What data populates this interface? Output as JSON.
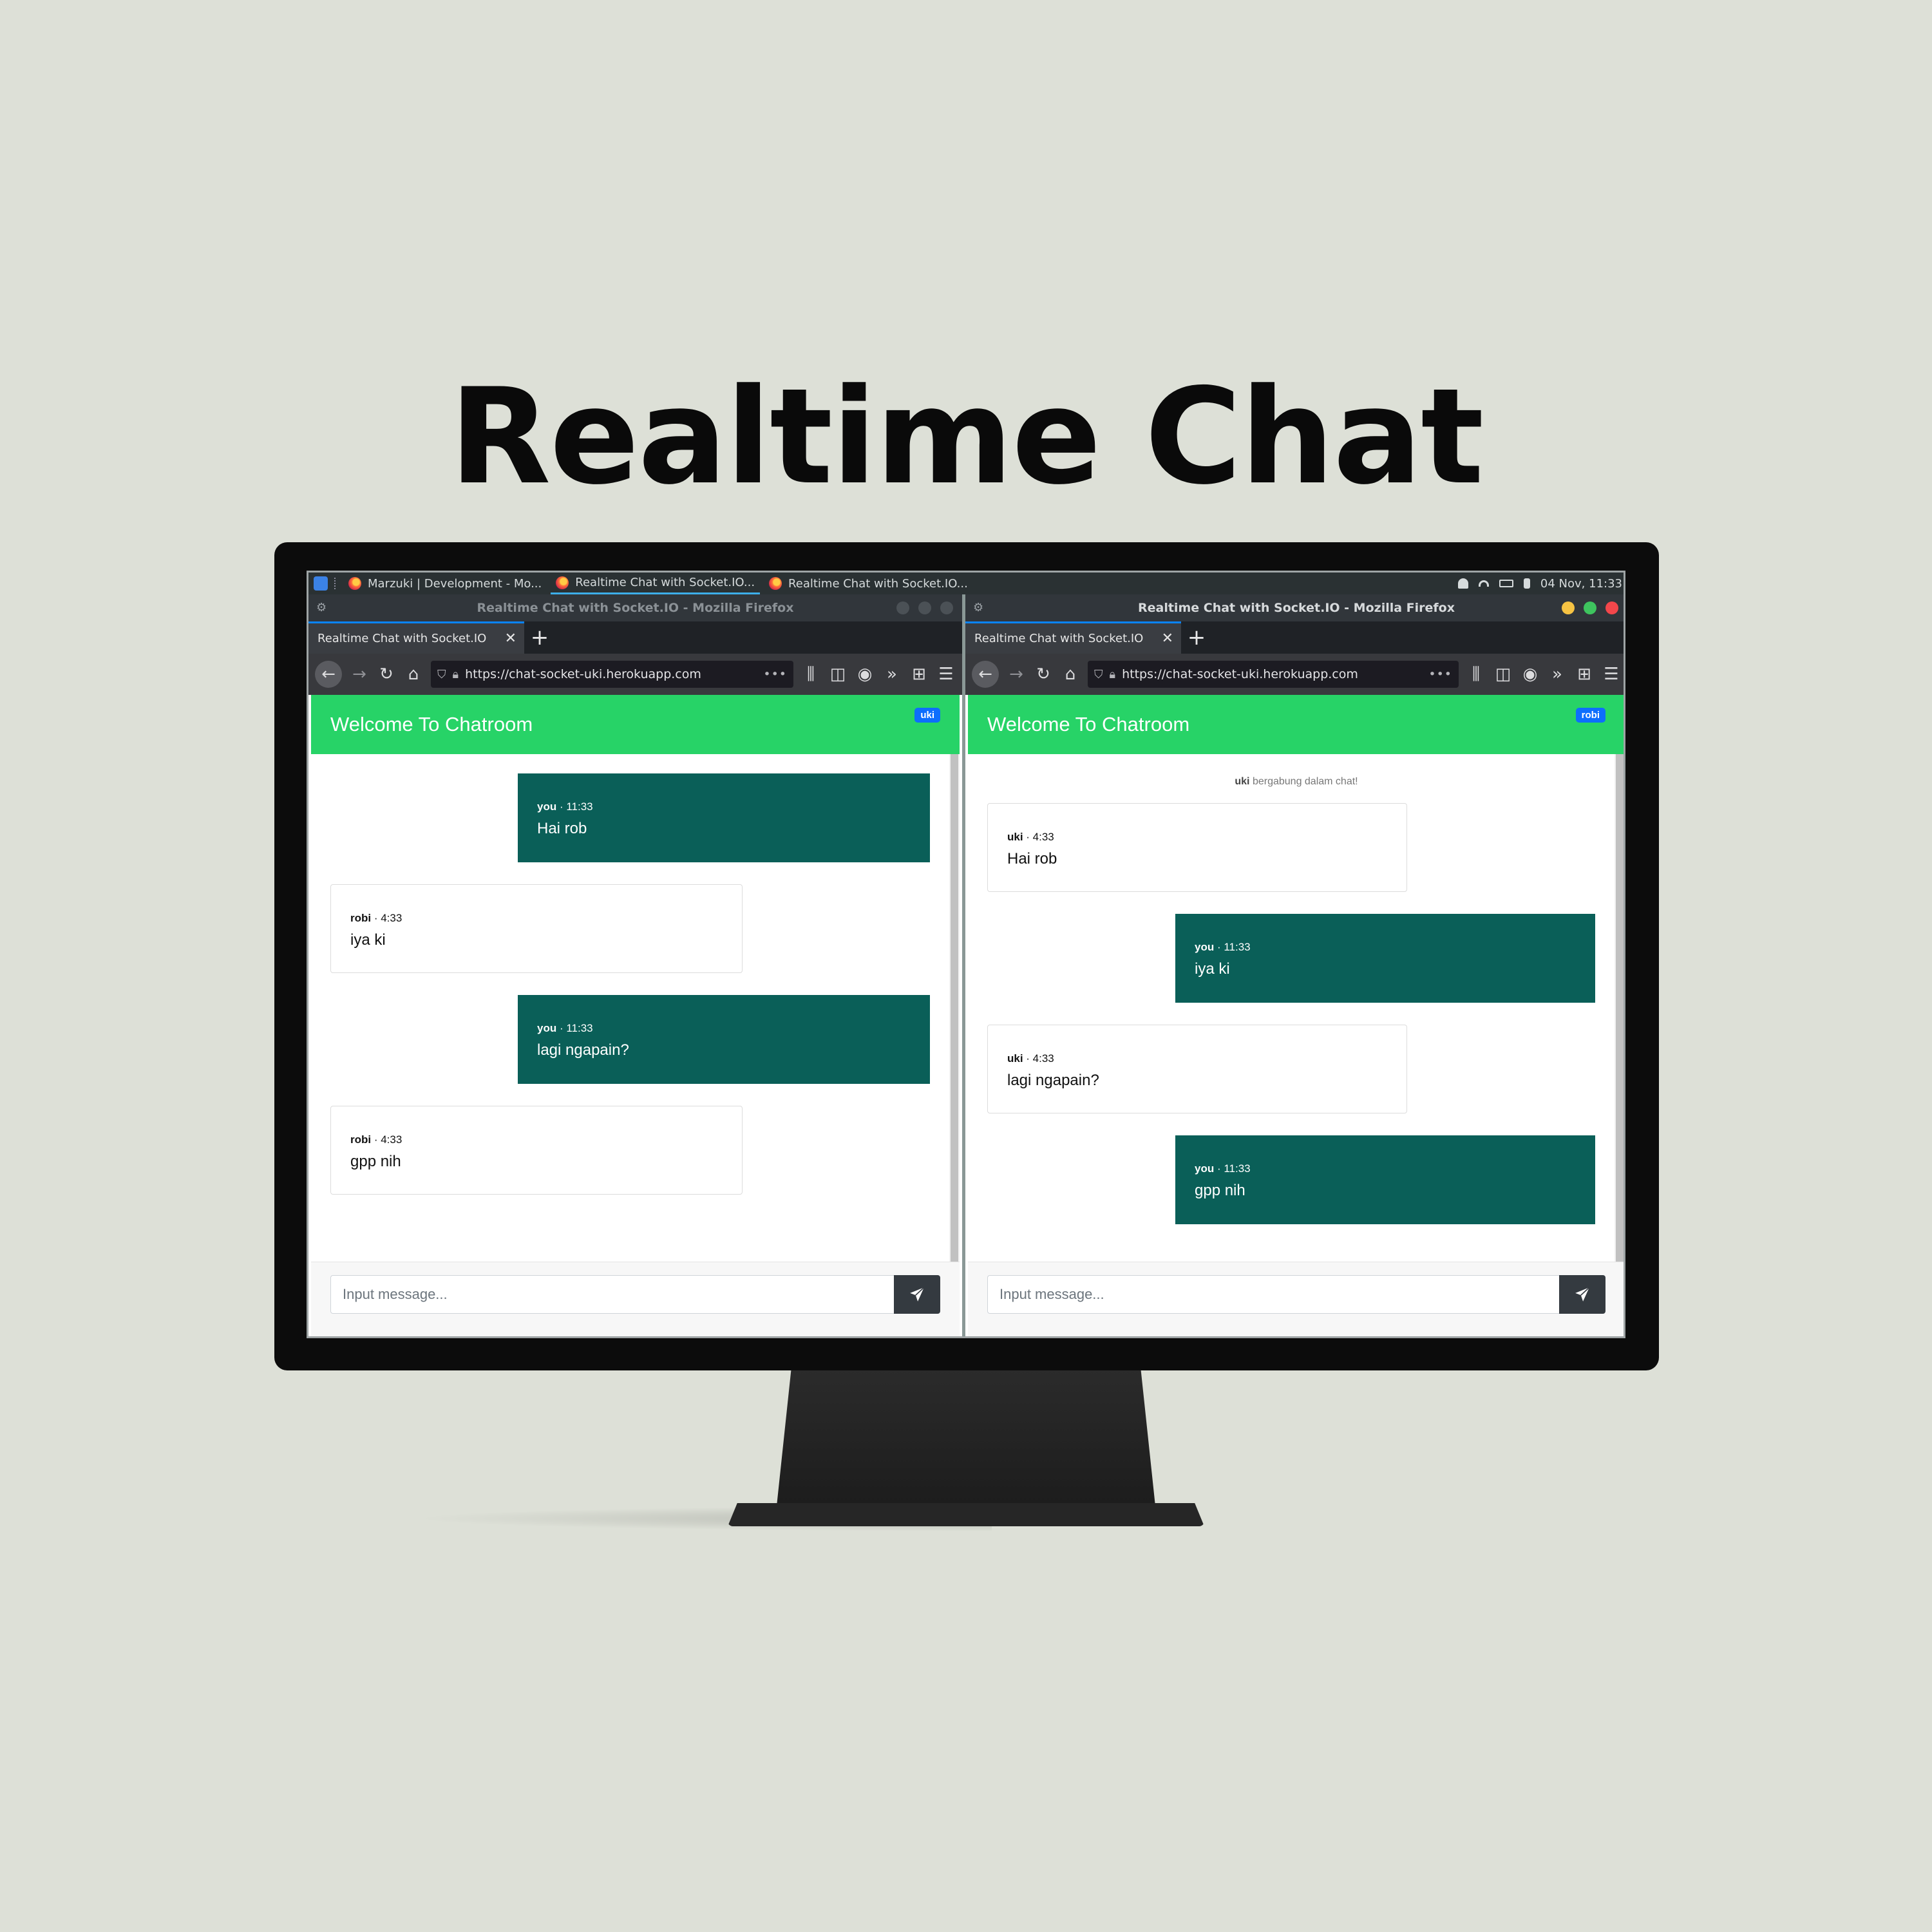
{
  "hero_title": "Realtime Chat",
  "taskbar": {
    "tasks": [
      "Marzuki | Development - Mo...",
      "Realtime Chat with Socket.IO...",
      "Realtime Chat with Socket.IO..."
    ],
    "clock": "04 Nov, 11:33"
  },
  "windows": [
    {
      "window_title": "Realtime Chat with Socket.IO - Mozilla Firefox",
      "tab_label": "Realtime Chat with Socket.IO",
      "url": "https://chat-socket-uki.herokuapp.com",
      "app_title": "Welcome To Chatroom",
      "user_badge": "uki",
      "messages": [
        {
          "sender": "you",
          "time": "11:33",
          "text": "Hai rob"
        },
        {
          "sender": "robi",
          "time": "4:33",
          "text": "iya ki"
        },
        {
          "sender": "you",
          "time": "11:33",
          "text": "lagi ngapain?"
        },
        {
          "sender": "robi",
          "time": "4:33",
          "text": "gpp nih"
        }
      ],
      "input_placeholder": "Input message..."
    },
    {
      "window_title": "Realtime Chat with Socket.IO - Mozilla Firefox",
      "tab_label": "Realtime Chat with Socket.IO",
      "url": "https://chat-socket-uki.herokuapp.com",
      "app_title": "Welcome To Chatroom",
      "user_badge": "robi",
      "system_user": "uki",
      "system_text": " bergabung dalam chat!",
      "messages": [
        {
          "sender": "uki",
          "time": "4:33",
          "text": "Hai rob"
        },
        {
          "sender": "you",
          "time": "11:33",
          "text": "iya ki"
        },
        {
          "sender": "uki",
          "time": "4:33",
          "text": "lagi ngapain?"
        },
        {
          "sender": "you",
          "time": "11:33",
          "text": "gpp nih"
        }
      ],
      "input_placeholder": "Input message..."
    }
  ],
  "meta_separator": " · ",
  "colors": {
    "header_green": "#27d367",
    "own_bubble": "#0a5f58",
    "badge_blue": "#0d6efd",
    "send_button": "#343a40",
    "background": "#dde0d7"
  }
}
